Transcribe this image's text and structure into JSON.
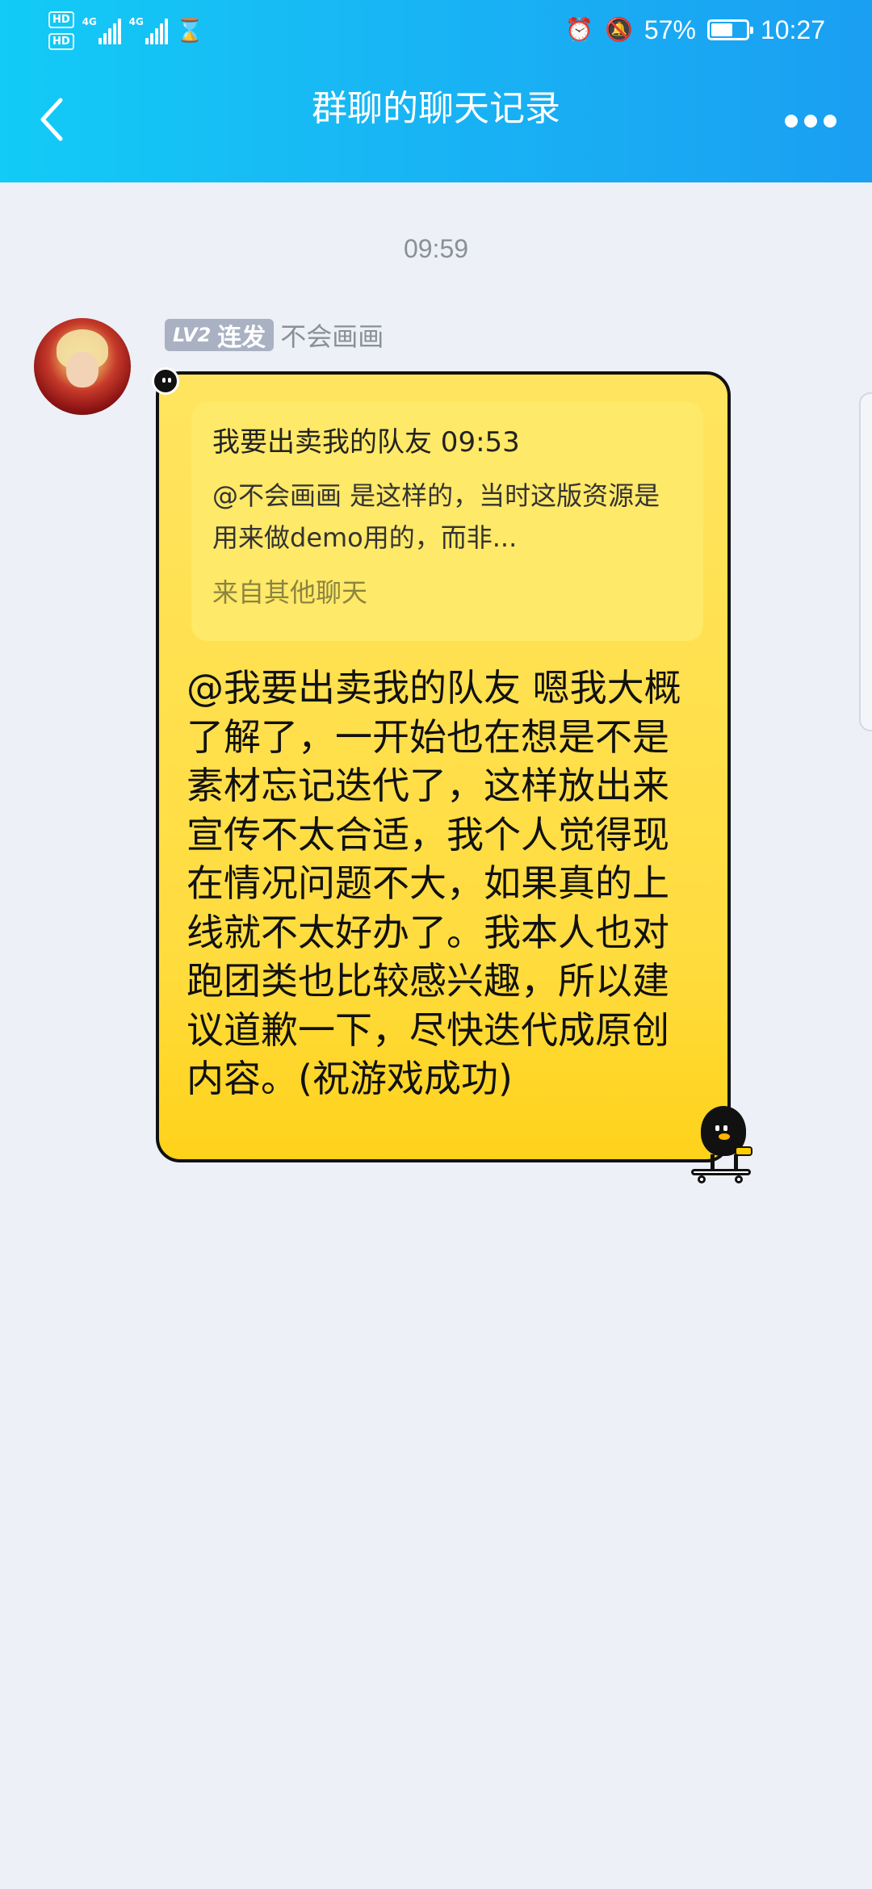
{
  "status_bar": {
    "hd1": "HD",
    "hd2": "HD",
    "net1": "4G",
    "net2": "4G",
    "battery_percent": "57%",
    "battery_level": 0.57,
    "time": "10:27",
    "icons": [
      "signal-icon",
      "hourglass-icon",
      "alarm-icon",
      "mute-bell-icon",
      "battery-icon"
    ]
  },
  "nav": {
    "title": "群聊的聊天记录",
    "back_icon": "chevron-left-icon",
    "more_icon": "more-dots-icon"
  },
  "chat": {
    "timestamp": "09:59",
    "message": {
      "level": "LV2",
      "member_title": "连发",
      "sender_name": "不会画画",
      "quote": {
        "header": "我要出卖我的队友 09:53",
        "body": "@不会画画 是这样的，当时这版资源是用来做demo用的，而非...",
        "source": "来自其他聊天"
      },
      "text": "@我要出卖我的队友 嗯我大概了解了，一开始也在想是不是素材忘记迭代了，这样放出来宣传不太合适，我个人觉得现在情况问题不大，如果真的上线就不太好办了。我本人也对跑团类也比较感兴趣，所以建议道歉一下，尽快迭代成原创内容。(祝游戏成功)"
    }
  },
  "colors": {
    "header_start": "#12cbf6",
    "header_end": "#1a9ff2",
    "bubble": "#ffdc3e",
    "background": "#edf0f6"
  }
}
